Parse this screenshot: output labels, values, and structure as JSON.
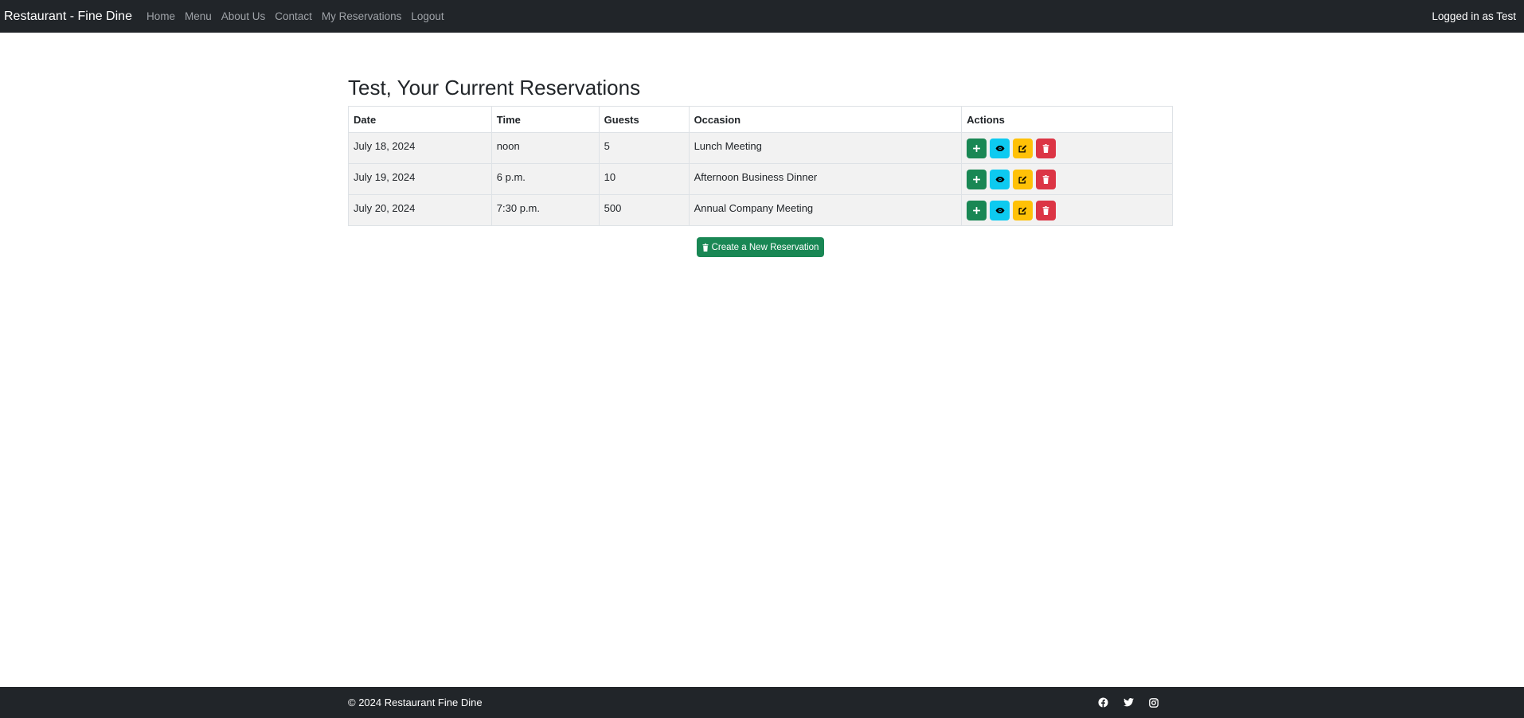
{
  "navbar": {
    "brand": "Restaurant - Fine Dine",
    "links": [
      "Home",
      "Menu",
      "About Us",
      "Contact",
      "My Reservations",
      "Logout"
    ],
    "user_status": "Logged in as Test"
  },
  "main": {
    "title": "Test, Your Current Reservations",
    "table": {
      "headers": [
        "Date",
        "Time",
        "Guests",
        "Occasion",
        "Actions"
      ],
      "rows": [
        {
          "date": "July 18, 2024",
          "time": "noon",
          "guests": "5",
          "occasion": "Lunch Meeting"
        },
        {
          "date": "July 19, 2024",
          "time": "6 p.m.",
          "guests": "10",
          "occasion": "Afternoon Business Dinner"
        },
        {
          "date": "July 20, 2024",
          "time": "7:30 p.m.",
          "guests": "500",
          "occasion": "Annual Company Meeting"
        }
      ],
      "action_icons": [
        "plus-icon",
        "eye-icon",
        "edit-icon",
        "trash-icon"
      ]
    },
    "create_button_label": "Create a New Reservation"
  },
  "footer": {
    "copyright": "© 2024 Restaurant Fine Dine",
    "social_icons": [
      "facebook-icon",
      "twitter-icon",
      "instagram-icon"
    ]
  },
  "colors": {
    "navbar_bg": "#212529",
    "success": "#198754",
    "info": "#0dcaf0",
    "warning": "#ffc107",
    "danger": "#dc3545"
  }
}
